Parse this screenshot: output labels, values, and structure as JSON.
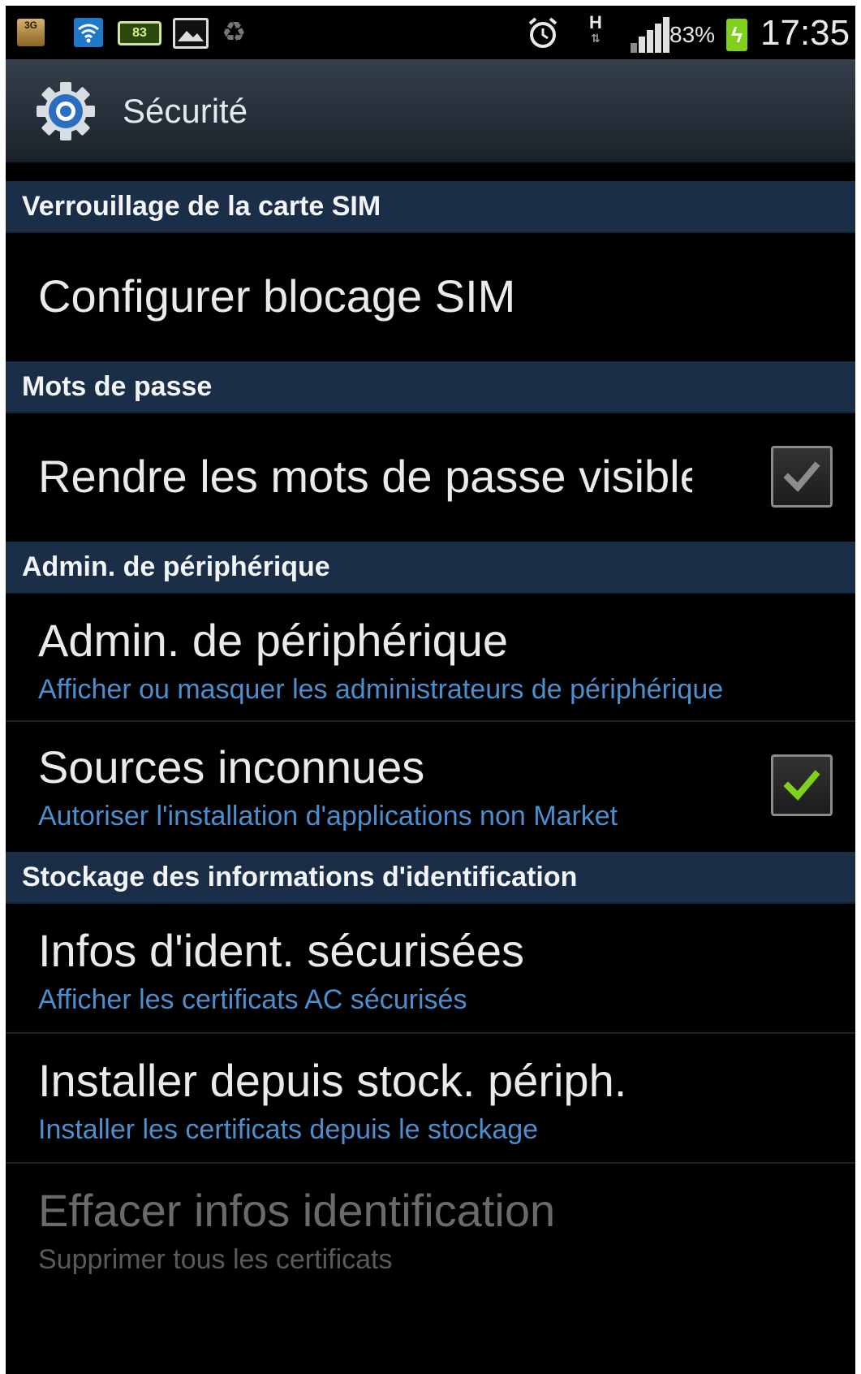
{
  "status_bar": {
    "network_type": "3G",
    "battery_note_value": "83",
    "data_indicator": "H",
    "data_arrows": "⇅",
    "battery_percent": "83%",
    "time": "17:35",
    "icons": [
      "3g-icon",
      "wifi-icon",
      "battery-notification-icon",
      "image-icon",
      "recycle-icon",
      "alarm-icon",
      "h-data-icon",
      "signal-icon",
      "battery-charging-icon"
    ]
  },
  "action_bar": {
    "title": "Sécurité",
    "icon": "gear-icon"
  },
  "sections": [
    {
      "label": "Verrouillage de la carte SIM",
      "items": [
        {
          "title": "Configurer blocage SIM",
          "summary": "",
          "checkbox": null,
          "enabled": true
        }
      ]
    },
    {
      "label": "Mots de passe",
      "items": [
        {
          "title": "Rendre les mots de passe visibles",
          "summary": "",
          "checkbox": "checked-disabled-grey",
          "enabled": true
        }
      ]
    },
    {
      "label": "Admin. de périphérique",
      "items": [
        {
          "title": "Admin. de périphérique",
          "summary": "Afficher ou masquer les administrateurs de périphérique",
          "checkbox": null,
          "enabled": true
        },
        {
          "title": "Sources inconnues",
          "summary": "Autoriser l'installation d'applications non Market",
          "checkbox": "checked-green",
          "enabled": true
        }
      ]
    },
    {
      "label": "Stockage des informations d'identification",
      "items": [
        {
          "title": "Infos d'ident. sécurisées",
          "summary": "Afficher les certificats AC sécurisés",
          "checkbox": null,
          "enabled": true
        },
        {
          "title": "Installer depuis stock. périph.",
          "summary": "Installer les certificats depuis le stockage",
          "checkbox": null,
          "enabled": true
        },
        {
          "title": "Effacer infos identification",
          "summary": "Supprimer tous les certificats",
          "checkbox": null,
          "enabled": false
        }
      ]
    }
  ],
  "colors": {
    "section_header_bg": "#1a2e48",
    "summary_text": "#4c8fce",
    "check_green": "#7fd11b",
    "check_grey": "#8c8c8c"
  }
}
